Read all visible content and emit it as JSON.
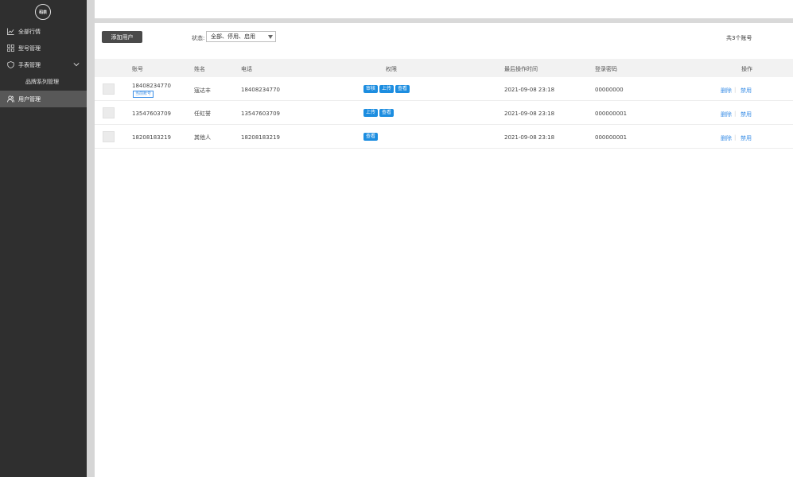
{
  "logo_text": "码表",
  "sidebar": {
    "items": [
      {
        "label": "全部行情",
        "icon": "line-chart-icon"
      },
      {
        "label": "型号管理",
        "icon": "grid-icon"
      },
      {
        "label": "手表管理",
        "icon": "shield-icon",
        "expanded": true
      },
      {
        "label": "品牌系列管理",
        "sub": true
      },
      {
        "label": "用户管理",
        "icon": "users-icon",
        "active": true
      }
    ]
  },
  "toolbar": {
    "add_label": "添加用户",
    "status_label": "状态:",
    "status_value": "全部、停用、启用",
    "total_text": "共3个账号"
  },
  "table": {
    "headers": {
      "account": "账号",
      "name": "姓名",
      "phone": "电话",
      "perms": "权限",
      "last_time": "最后操作时间",
      "password": "登录密码",
      "ops": "操作"
    },
    "rows": [
      {
        "account": "18408234770",
        "badge": "当前账号",
        "name": "寇达丰",
        "phone": "18408234770",
        "perms": [
          "审核",
          "上传",
          "查看"
        ],
        "last_time": "2021-09-08 23:18",
        "password": "00000000",
        "op_delete": "删除",
        "op_disable": "禁用"
      },
      {
        "account": "13547603709",
        "badge": "",
        "name": "任虹誉",
        "phone": "13547603709",
        "perms": [
          "上传",
          "查看"
        ],
        "last_time": "2021-09-08 23:18",
        "password": "000000001",
        "op_delete": "删除",
        "op_disable": "禁用"
      },
      {
        "account": "18208183219",
        "badge": "",
        "name": "其他人",
        "phone": "18208183219",
        "perms": [
          "查看"
        ],
        "last_time": "2021-09-08 23:18",
        "password": "000000001",
        "op_delete": "删除",
        "op_disable": "禁用"
      }
    ]
  },
  "colors": {
    "sidebar_bg": "#2f2f2f",
    "sidebar_active": "#585858",
    "tag_blue": "#1c8de0",
    "link_blue": "#3a8ee6"
  }
}
